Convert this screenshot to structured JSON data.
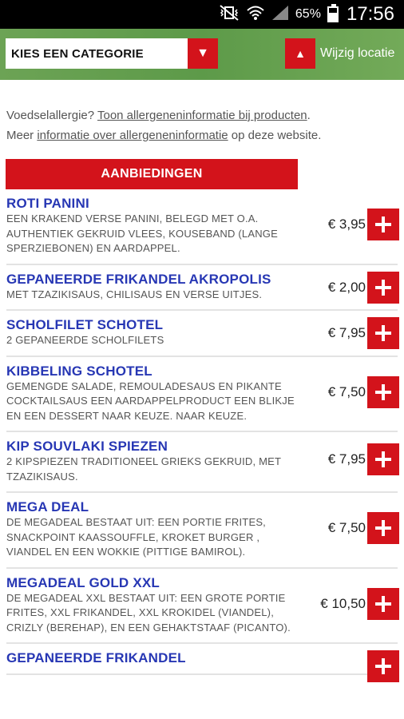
{
  "status_bar": {
    "battery_pct": "65%",
    "time": "17:56",
    "icons": [
      "mute-vibrate-icon",
      "wifi-icon",
      "cell-signal-icon",
      "battery-icon"
    ]
  },
  "header": {
    "category_select": "KIES EEN CATEGORIE",
    "location_label": "Wijzig locatie",
    "accent_color": "#d3131b",
    "bg_color": "#6ca355"
  },
  "allergy": {
    "line1_prefix": "Voedselallergie? ",
    "line1_link": "Toon allergeneninformatie bij producten",
    "line1_suffix": ".",
    "line2_prefix": "Meer ",
    "line2_link": "informatie over allergeneninformatie",
    "line2_suffix": " op deze website."
  },
  "offers_title": "AANBIEDINGEN",
  "products": [
    {
      "name": "ROTI PANINI",
      "desc": "EEN KRAKEND VERSE PANINI, BELEGD MET O.A. AUTHENTIEK GEKRUID VLEES, KOUSEBAND (LANGE SPERZIEBONEN) EN AARDAPPEL.",
      "price": "€ 3,95"
    },
    {
      "name": "GEPANEERDE FRIKANDEL AKROPOLIS",
      "desc": "MET TZAZIKISAUS, CHILISAUS EN VERSE UITJES.",
      "price": "€ 2,00"
    },
    {
      "name": "SCHOLFILET SCHOTEL",
      "desc": "2 GEPANEERDE SCHOLFILETS",
      "price": "€ 7,95"
    },
    {
      "name": "KIBBELING SCHOTEL",
      "desc": "GEMENGDE SALADE, REMOULADESAUS EN PIKANTE COCKTAILSAUS EEN AARDAPPELPRODUCT EEN BLIKJE EN EEN DESSERT NAAR KEUZE. NAAR KEUZE.",
      "price": "€ 7,50"
    },
    {
      "name": "KIP SOUVLAKI SPIEZEN",
      "desc": "2 KIPSPIEZEN TRADITIONEEL GRIEKS GEKRUID, MET TZAZIKISAUS.",
      "price": "€ 7,95"
    },
    {
      "name": "MEGA DEAL",
      "desc": "DE MEGADEAL BESTAAT UIT: EEN PORTIE FRITES, SNACKPOINT KAASSOUFFLE, KROKET BURGER , VIANDEL EN EEN WOKKIE (PITTIGE BAMIROL).",
      "price": "€ 7,50"
    },
    {
      "name": "MEGADEAL GOLD XXL",
      "desc": "DE MEGADEAL XXL BESTAAT UIT: EEN GROTE PORTIE FRITES, XXL FRIKANDEL, XXL KROKIDEL (VIANDEL), CRIZLY (BEREHAP), EN EEN GEHAKTSTAAF (PICANTO).",
      "price": "€ 10,50"
    },
    {
      "name": "GEPANEERDE FRIKANDEL",
      "desc": "",
      "price": ""
    }
  ]
}
